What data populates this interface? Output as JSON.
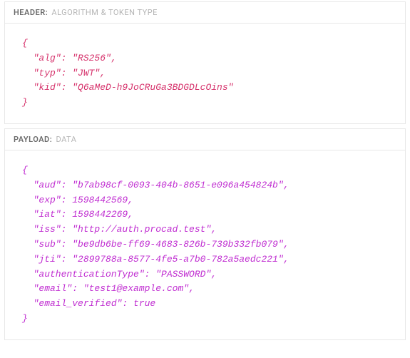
{
  "sections": {
    "header": {
      "prefix": "HEADER:",
      "suffix": "ALGORITHM & TOKEN TYPE",
      "json": {
        "alg": "RS256",
        "typ": "JWT",
        "kid": "Q6aMeD-h9JoCRuGa3BDGDLcOins"
      }
    },
    "payload": {
      "prefix": "PAYLOAD:",
      "suffix": "DATA",
      "json": {
        "aud": "b7ab98cf-0093-404b-8651-e096a454824b",
        "exp": 1598442569,
        "iat": 1598442269,
        "iss": "http://auth.procad.test",
        "sub": "be9db6be-ff69-4683-826b-739b332fb079",
        "jti": "2899788a-8577-4fe5-a7b0-782a5aedc221",
        "authenticationType": "PASSWORD",
        "email": "test1@example.com",
        "email_verified": true
      }
    }
  }
}
